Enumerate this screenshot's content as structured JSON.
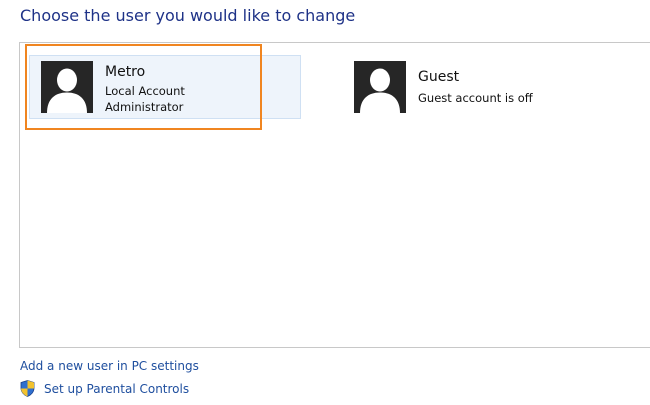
{
  "page": {
    "title": "Choose the user you would like to change"
  },
  "accounts": [
    {
      "name": "Metro",
      "lines": [
        "Local Account",
        "Administrator"
      ],
      "avatar_icon": "user-silhouette-icon",
      "selected": true
    },
    {
      "name": "Guest",
      "lines": [
        "Guest account is off"
      ],
      "avatar_icon": "user-silhouette-icon",
      "selected": false
    }
  ],
  "links": {
    "add_user": "Add a new user in PC settings",
    "parental_controls": "Set up Parental Controls",
    "parental_icon": "shield-icon"
  },
  "colors": {
    "title": "#1e3287",
    "link": "#1e4e9e",
    "selection_outline": "#f08520",
    "tile_hover_bg": "#eef4fb",
    "avatar_bg": "#262626"
  }
}
